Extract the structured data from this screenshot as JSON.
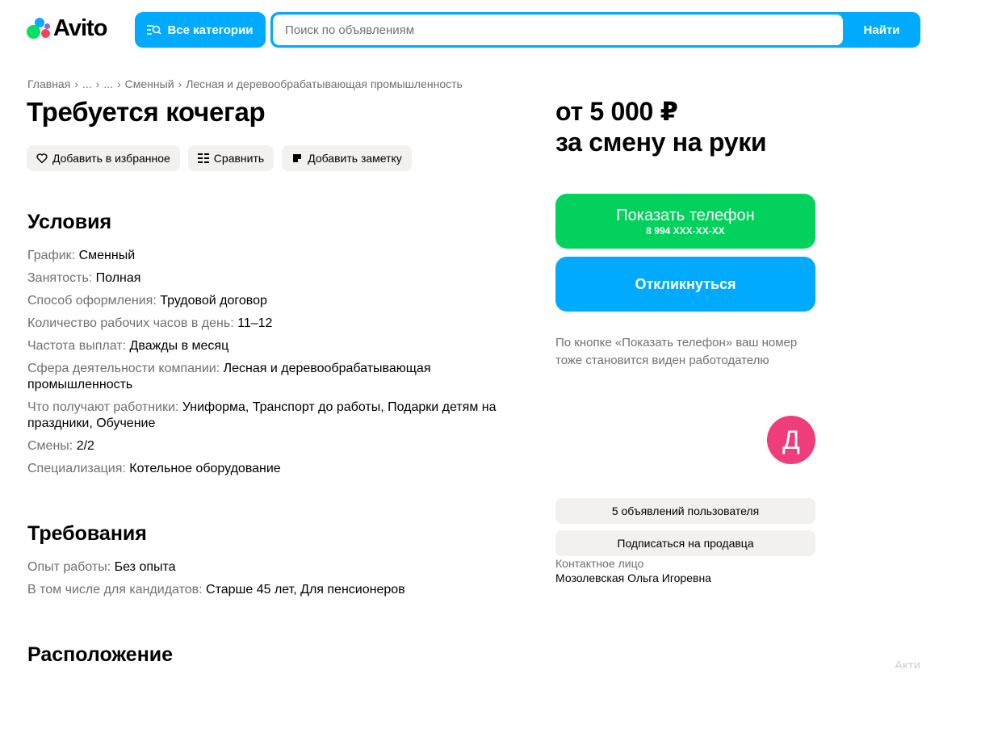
{
  "header": {
    "logo_text": "Avito",
    "categories_label": "Все категории",
    "search_placeholder": "Поиск по объявлениям",
    "search_button": "Найти"
  },
  "breadcrumb": [
    "Главная",
    "...",
    "...",
    "Сменный",
    "Лесная и деревообрабатывающая промышленность"
  ],
  "title": "Требуется кочегар",
  "actions": {
    "favorite": "Добавить в избранное",
    "compare": "Сравнить",
    "note": "Добавить заметку"
  },
  "conditions": {
    "heading": "Условия",
    "rows": [
      {
        "k": "График:",
        "v": "Сменный"
      },
      {
        "k": "Занятость:",
        "v": "Полная"
      },
      {
        "k": "Способ оформления:",
        "v": "Трудовой договор"
      },
      {
        "k": "Количество рабочих часов в день:",
        "v": "11–12"
      },
      {
        "k": "Частота выплат:",
        "v": "Дважды в месяц"
      },
      {
        "k": "Сфера деятельности компании:",
        "v": "Лесная и деревообрабатывающая промышленность"
      },
      {
        "k": "Что получают работники:",
        "v": "Униформа, Транспорт до работы, Подарки детям на праздники, Обучение"
      },
      {
        "k": "Смены:",
        "v": "2/2"
      },
      {
        "k": "Специализация:",
        "v": "Котельное оборудование"
      }
    ]
  },
  "requirements": {
    "heading": "Требования",
    "rows": [
      {
        "k": "Опыт работы:",
        "v": "Без опыта"
      },
      {
        "k": "В том числе для кандидатов:",
        "v": "Старше 45 лет, Для пенсионеров"
      }
    ]
  },
  "location": {
    "heading": "Расположение"
  },
  "price": {
    "line1": "от 5 000 ₽",
    "line2": "за смену на руки"
  },
  "contact": {
    "show_phone_label": "Показать телефон",
    "phone_masked": "8 994 XXX-XX-XX",
    "respond_label": "Откликнуться",
    "note": "По кнопке «Показать телефон» ваш номер тоже становится виден работодателю",
    "avatar_letter": "Д",
    "listings_label": "5 объявлений пользователя",
    "subscribe_label": "Подписаться на продавца",
    "person_label": "Контактное лицо",
    "person_name": "Мозолевская Ольга Игоревна"
  },
  "faded_text": "Акти",
  "colors": {
    "accent_blue": "#00aaff",
    "phone_green": "#02d15c",
    "avatar_pink": "#ef3d7c",
    "chip_gray": "#f2f1f0",
    "muted_text": "#70706f"
  },
  "icons": [
    "categories-search-icon",
    "heart-icon",
    "compare-icon",
    "note-icon"
  ]
}
